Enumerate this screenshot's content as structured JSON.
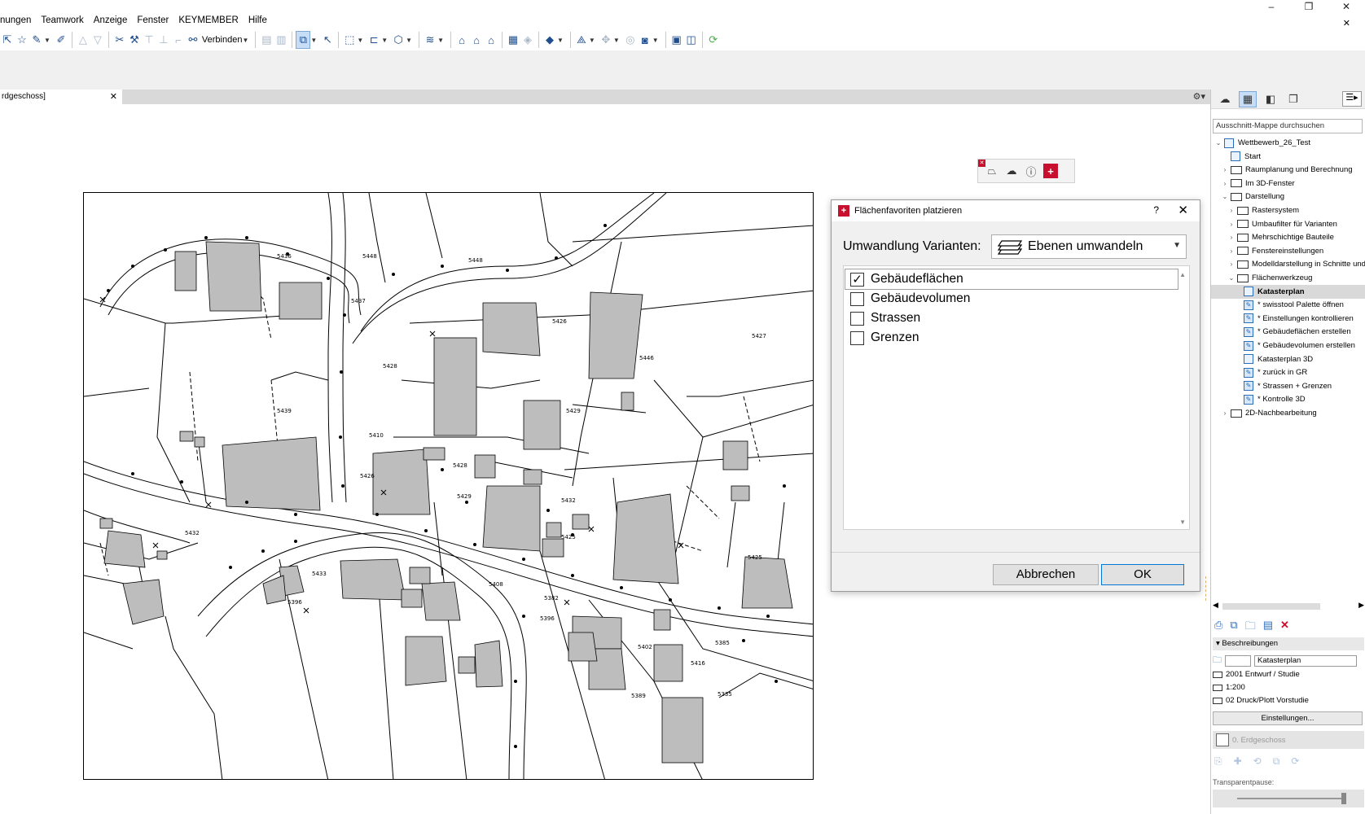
{
  "menu": {
    "items": [
      "nungen",
      "Teamwork",
      "Anzeige",
      "Fenster",
      "KEYMEMBER",
      "Hilfe"
    ]
  },
  "window_controls": {
    "minimize": "–",
    "restore": "❐",
    "close": "✕",
    "doc_close": "✕"
  },
  "toolbar": {
    "connect_label": "Verbinden"
  },
  "tab": {
    "label": "rdgeschoss]",
    "close": "✕"
  },
  "palette": {
    "icons": [
      "polygon-icon",
      "cloud-plan-icon",
      "info-icon",
      "swiss-logo-icon"
    ]
  },
  "dialog": {
    "title": "Flächenfavoriten platzieren",
    "help": "?",
    "close": "✕",
    "variant_label": "Umwandlung Varianten:",
    "variant_value": "Ebenen umwandeln",
    "items": [
      {
        "label": "Gebäudeflächen",
        "checked": true
      },
      {
        "label": "Gebäudevolumen",
        "checked": false
      },
      {
        "label": "Strassen",
        "checked": false
      },
      {
        "label": "Grenzen",
        "checked": false
      }
    ],
    "cancel_label": "Abbrechen",
    "ok_label": "OK"
  },
  "navigator": {
    "search_placeholder": "Ausschnitt-Mappe durchsuchen",
    "tree": [
      {
        "label": "Wettbewerb_26_Test",
        "type": "root",
        "level": 0,
        "expanded": true
      },
      {
        "label": "Start",
        "type": "view",
        "level": 1
      },
      {
        "label": "Raumplanung und Berechnung",
        "type": "folder",
        "level": 1
      },
      {
        "label": "Im 3D-Fenster",
        "type": "folder",
        "level": 1
      },
      {
        "label": "Darstellung",
        "type": "folder",
        "level": 1,
        "expanded": true
      },
      {
        "label": "Rastersystem",
        "type": "folder",
        "level": 2
      },
      {
        "label": "Umbaufilter für Varianten",
        "type": "folder",
        "level": 2
      },
      {
        "label": "Mehrschichtige Bauteile",
        "type": "folder",
        "level": 2
      },
      {
        "label": "Fenstereinstellungen",
        "type": "folder",
        "level": 2
      },
      {
        "label": "Modelldarstellung in Schnitte und",
        "type": "folder",
        "level": 2
      },
      {
        "label": "Flächenwerkzeug",
        "type": "folder",
        "level": 2,
        "expanded": true
      },
      {
        "label": "Katasterplan",
        "type": "view",
        "level": 3,
        "selected": true
      },
      {
        "label": "* swisstool Palette öffnen",
        "type": "pen",
        "level": 3
      },
      {
        "label": "* Einstellungen kontrollieren",
        "type": "pen",
        "level": 3
      },
      {
        "label": "* Gebäudeflächen erstellen",
        "type": "pen",
        "level": 3
      },
      {
        "label": "* Gebäudevolumen erstellen",
        "type": "pen",
        "level": 3
      },
      {
        "label": "Katasterplan 3D",
        "type": "view",
        "level": 3
      },
      {
        "label": "* zurück in GR",
        "type": "pen",
        "level": 3
      },
      {
        "label": "* Strassen + Grenzen",
        "type": "pen",
        "level": 3
      },
      {
        "label": "* Kontrolle 3D",
        "type": "pen",
        "level": 3
      },
      {
        "label": "2D-Nachbearbeitung",
        "type": "folder",
        "level": 1
      }
    ],
    "section_title": "Beschreibungen",
    "name_value": "Katasterplan",
    "layer_combo": "2001 Entwurf / Studie",
    "scale": "1:200",
    "pen_set": "02 Druck/Plott Vorstudie",
    "settings_button": "Einstellungen...",
    "story": "0. Erdgeschoss",
    "transparency_label": "Transparentpause:"
  },
  "plan_labels": [
    "5436",
    "5448",
    "5448",
    "5437",
    "5428",
    "5426",
    "5427",
    "5446",
    "5439",
    "5429",
    "5428",
    "5426",
    "5429",
    "5432",
    "5425",
    "5432",
    "5433",
    "5396",
    "5408",
    "5335",
    "5389",
    "5402",
    "5416",
    "5385",
    "5425",
    "5382",
    "5396",
    "5410"
  ],
  "colors": {
    "accent": "#c8102e",
    "selection": "#c7dcf5",
    "building": "#bdbdbd"
  }
}
